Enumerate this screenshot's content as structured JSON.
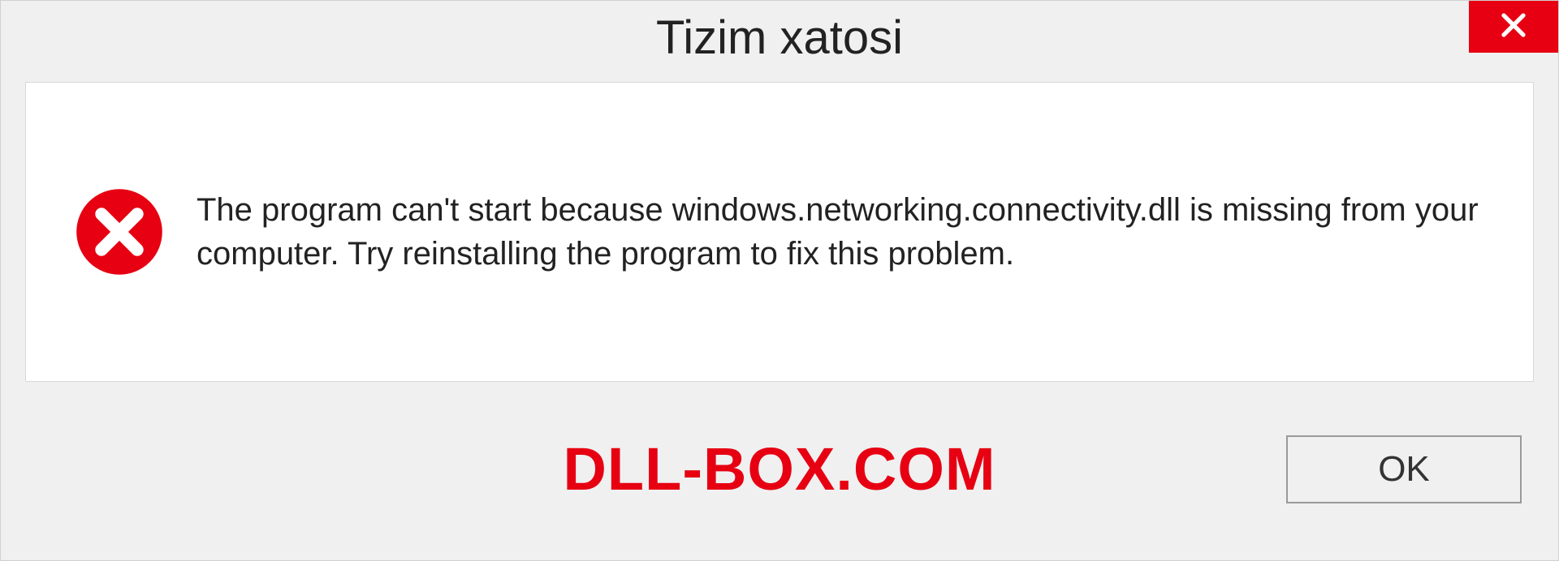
{
  "dialog": {
    "title": "Tizim xatosi",
    "message": "The program can't start because windows.networking.connectivity.dll is missing from your computer. Try reinstalling the program to fix this problem.",
    "ok_label": "OK"
  },
  "watermark": "DLL-BOX.COM",
  "colors": {
    "accent_red": "#e60012"
  }
}
